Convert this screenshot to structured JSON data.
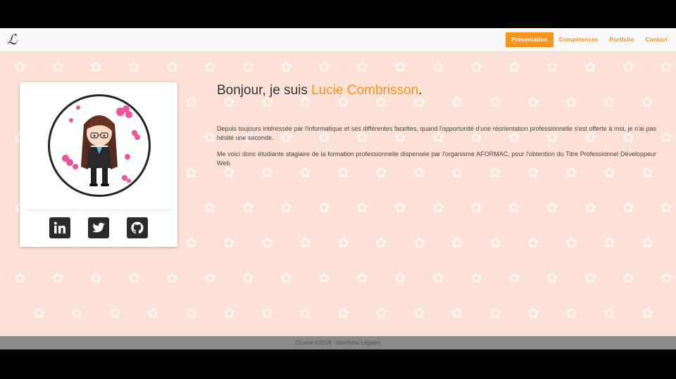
{
  "header": {
    "logo_text": "ℒ",
    "nav": [
      {
        "label": "Présentation",
        "active": true
      },
      {
        "label": "Compétences",
        "active": false
      },
      {
        "label": "Portfolio",
        "active": false
      },
      {
        "label": "Contact",
        "active": false
      }
    ]
  },
  "profile": {
    "avatar_icon": "chibi-avatar",
    "social": [
      {
        "icon": "linkedin-icon"
      },
      {
        "icon": "twitter-icon"
      },
      {
        "icon": "github-icon"
      }
    ]
  },
  "intro": {
    "greeting": "Bonjour, je suis ",
    "name": "Lucie Combrisson",
    "period": ".",
    "paragraph1": "Depuis toujours intéressée par l'informatique et ses différentes facettes, quand l'opportunité d'une réorientation professionnelle s'est offerte à moi, je n'ai pas hésité une seconde.",
    "paragraph2": "Me voici donc étudiante stagiaire de la formation professionnelle dispensée par l'organisme AFORMAC, pour l'obtention du Titre Professionnel Développeur Web."
  },
  "footer": {
    "text": "CLucie ©2018 - Mentions Légales"
  },
  "colors": {
    "accent": "#f7931e",
    "background": "#fde0d6",
    "footer": "#8a8a8a"
  }
}
